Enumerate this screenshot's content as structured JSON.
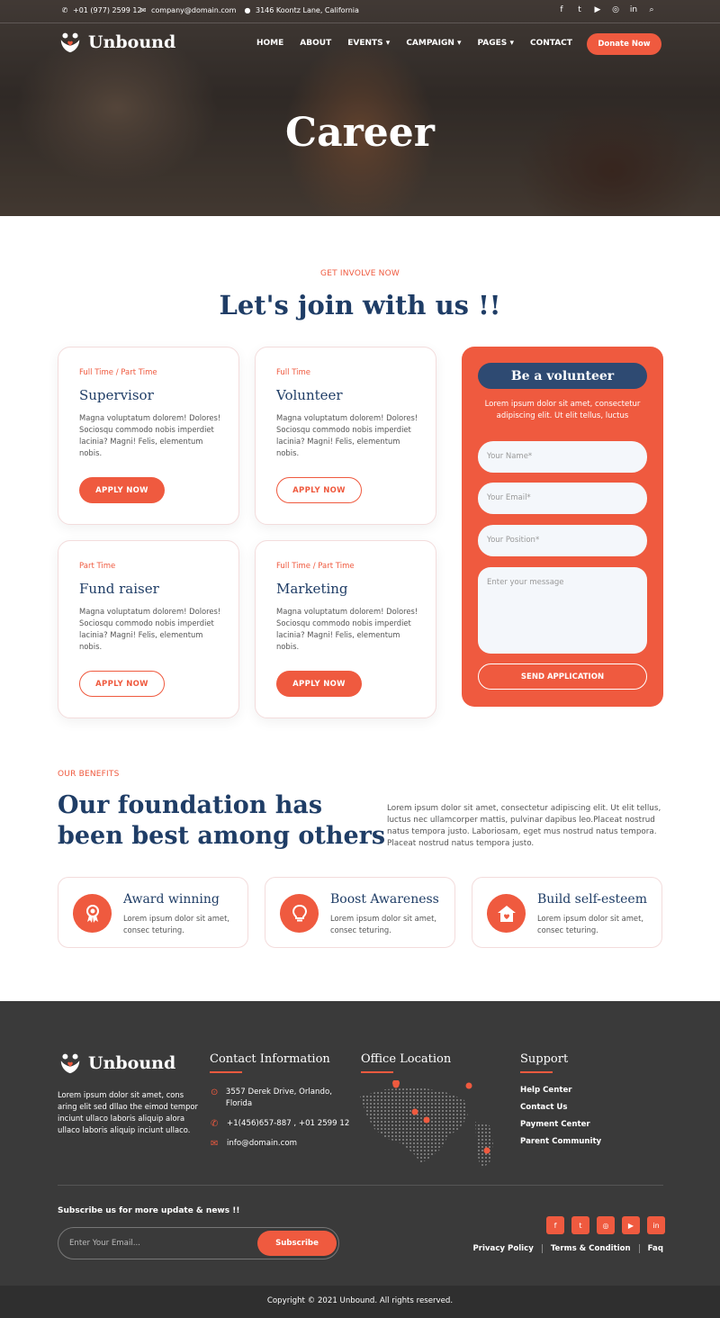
{
  "topbar": {
    "phone": "+01 (977) 2599 12",
    "email": "company@domain.com",
    "address": "3146 Koontz Lane, California"
  },
  "brand": {
    "name": "Unbound"
  },
  "nav": {
    "items": [
      "HOME",
      "ABOUT",
      "EVENTS",
      "CAMPAIGN",
      "PAGES",
      "CONTACT"
    ],
    "donate_label": "Donate Now"
  },
  "hero": {
    "title": "Career"
  },
  "join": {
    "eyebrow": "GET INVOLVE NOW",
    "heading": "Let's join with us !!",
    "cards": [
      {
        "tag": "Full Time / Part Time",
        "title": "Supervisor",
        "desc": "Magna voluptatum dolorem! Dolores! Sociosqu commodo nobis imperdiet lacinia? Magni! Felis, elementum nobis.",
        "button": "APPLY NOW"
      },
      {
        "tag": "Full Time",
        "title": "Volunteer",
        "desc": "Magna voluptatum dolorem! Dolores! Sociosqu commodo nobis imperdiet lacinia? Magni! Felis, elementum nobis.",
        "button": "APPLY NOW"
      },
      {
        "tag": "Part Time",
        "title": "Fund raiser",
        "desc": "Magna voluptatum dolorem! Dolores! Sociosqu commodo nobis imperdiet lacinia? Magni! Felis, elementum nobis.",
        "button": "APPLY NOW"
      },
      {
        "tag": "Full Time / Part Time",
        "title": "Marketing",
        "desc": "Magna voluptatum dolorem! Dolores! Sociosqu commodo nobis imperdiet lacinia? Magni! Felis, elementum nobis.",
        "button": "APPLY NOW"
      }
    ]
  },
  "volunteer": {
    "title": "Be a volunteer",
    "intro": "Lorem ipsum dolor sit amet, consectetur adipiscing elit. Ut elit tellus, luctus",
    "name_placeholder": "Your Name*",
    "email_placeholder": "Your Email*",
    "position_placeholder": "Your Position*",
    "message_placeholder": "Enter your message",
    "send_label": "SEND APPLICATION"
  },
  "benefits": {
    "eyebrow": "OUR BENEFITS",
    "heading_line1": "Our foundation has",
    "heading_line2": "been best among others",
    "desc": "Lorem ipsum dolor sit amet, consectetur adipiscing elit. Ut elit tellus, luctus nec ullamcorper mattis, pulvinar dapibus leo.Placeat nostrud natus tempora justo. Laboriosam, eget mus nostrud natus tempora. Placeat nostrud natus tempora justo.",
    "items": [
      {
        "title": "Award winning",
        "desc": "Lorem ipsum dolor sit amet, consec teturing.",
        "icon": "award-icon"
      },
      {
        "title": "Boost Awareness",
        "desc": "Lorem ipsum dolor sit amet, consec teturing.",
        "icon": "lightbulb-icon"
      },
      {
        "title": "Build self-esteem",
        "desc": "Lorem ipsum dolor sit amet, consec teturing.",
        "icon": "home-heart-icon"
      }
    ]
  },
  "footer": {
    "about": "Lorem ipsum dolor sit amet, cons aring elit sed dllao the eimod tempor inciunt ullaco laboris aliquip alora ullaco laboris aliquip inciunt ullaco.",
    "contact_heading": "Contact Information",
    "contact_address": "3557 Derek Drive, Orlando, Florida",
    "contact_phone": "+1(456)657-887 , +01 2599 12",
    "contact_email": "info@domain.com",
    "office_heading": "Office Location",
    "support_heading": "Support",
    "support_links": [
      "Help Center",
      "Contact Us",
      "Payment Center",
      "Parent Community"
    ],
    "subscribe_title": "Subscribe us for more update & news !!",
    "subscribe_placeholder": "Enter Your Email...",
    "subscribe_button": "Subscribe",
    "legal_links": [
      "Privacy Policy",
      "Terms & Condition",
      "Faq"
    ],
    "copyright": "Copyright © 2021 Unbound. All rights reserved."
  },
  "colors": {
    "accent": "#ef5a3f",
    "navy": "#1f3d66",
    "footer": "#3a3a3a"
  }
}
